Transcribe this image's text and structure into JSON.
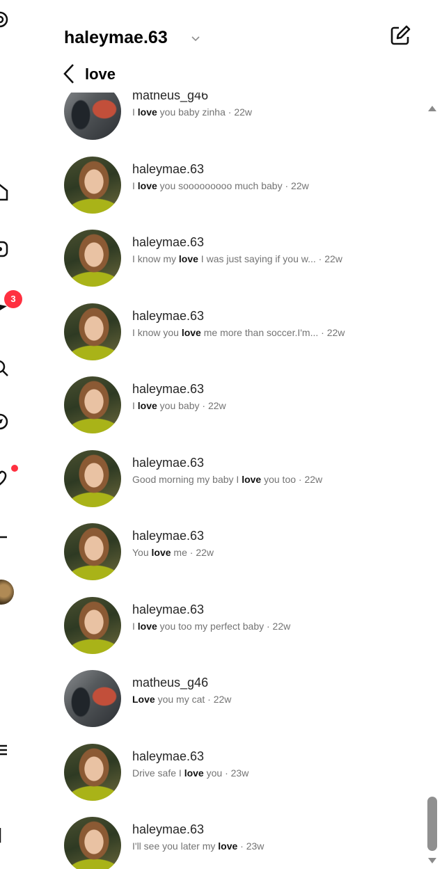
{
  "header": {
    "username": "haleymae.63",
    "search_query": "love"
  },
  "nav": {
    "notification_count": "3",
    "icons": [
      "threads-icon",
      "home-icon",
      "reels-icon",
      "messages-icon",
      "search-icon",
      "explore-icon",
      "notifications-icon",
      "create-icon",
      "profile-avatar",
      "more-icon",
      "meta-icon"
    ]
  },
  "results": [
    {
      "avatar": "matheus",
      "name": "matheus_g46",
      "pre": "I ",
      "hit": "love",
      "post": " you baby zinha",
      "time": " · 22w"
    },
    {
      "avatar": "haley",
      "name": "haleymae.63",
      "pre": "I ",
      "hit": "love",
      "post": " you sooooooooo much baby",
      "time": " · 22w"
    },
    {
      "avatar": "haley",
      "name": "haleymae.63",
      "pre": "I know my ",
      "hit": "love",
      "post": " I was just saying if you w...",
      "time": " · 22w"
    },
    {
      "avatar": "haley",
      "name": "haleymae.63",
      "pre": "I know you ",
      "hit": "love",
      "post": " me more than soccer.I'm...",
      "time": " · 22w"
    },
    {
      "avatar": "haley",
      "name": "haleymae.63",
      "pre": "I ",
      "hit": "love",
      "post": " you baby",
      "time": " · 22w"
    },
    {
      "avatar": "haley",
      "name": "haleymae.63",
      "pre": "Good morning my baby I ",
      "hit": "love",
      "post": " you too",
      "time": " · 22w"
    },
    {
      "avatar": "haley",
      "name": "haleymae.63",
      "pre": "You ",
      "hit": "love",
      "post": " me",
      "time": " · 22w"
    },
    {
      "avatar": "haley",
      "name": "haleymae.63",
      "pre": "I ",
      "hit": "love",
      "post": " you too my perfect baby",
      "time": " · 22w"
    },
    {
      "avatar": "matheus",
      "name": "matheus_g46",
      "pre": "",
      "hit": "Love",
      "post": " you my cat",
      "time": " · 22w"
    },
    {
      "avatar": "haley",
      "name": "haleymae.63",
      "pre": "Drive safe I ",
      "hit": "love",
      "post": " you",
      "time": " · 23w"
    },
    {
      "avatar": "haley",
      "name": "haleymae.63",
      "pre": "I'll see you later my ",
      "hit": "love",
      "post": "",
      "time": " · 23w"
    }
  ],
  "colors": {
    "badge": "#ff3040",
    "secondary_text": "#737373",
    "primary_text": "#262626"
  }
}
